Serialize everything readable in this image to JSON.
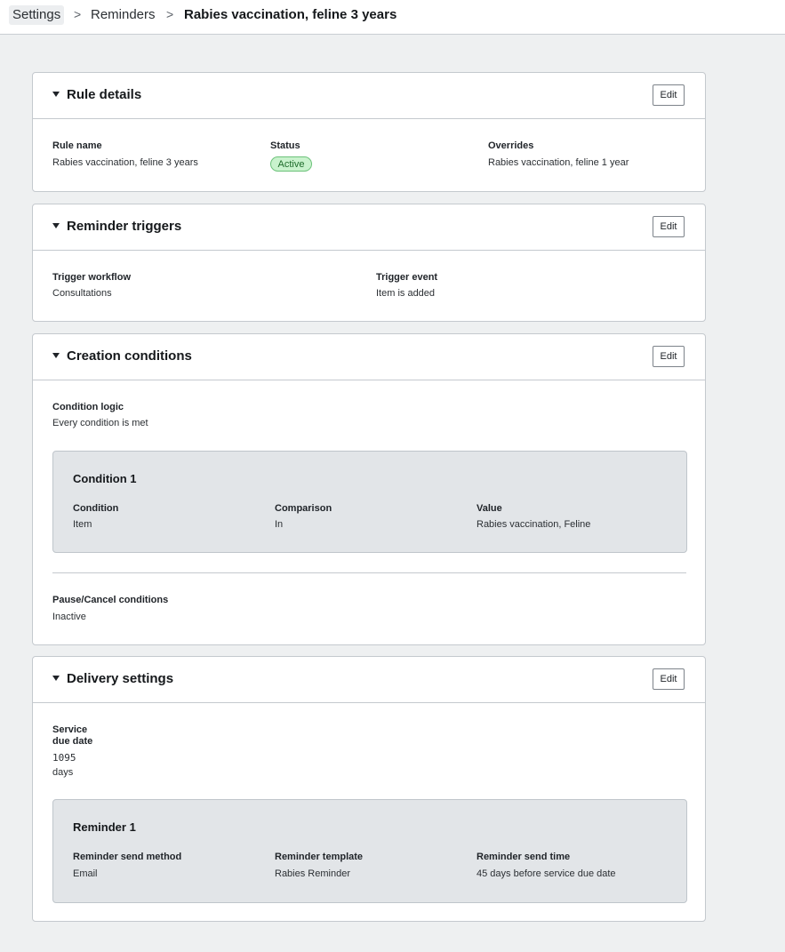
{
  "breadcrumb": {
    "items": [
      "Settings",
      "Reminders"
    ],
    "current": "Rabies vaccination, feline 3 years",
    "separator": ">"
  },
  "edit_label": "Edit",
  "rule_details": {
    "title": "Rule details",
    "rule_name_label": "Rule name",
    "rule_name": "Rabies vaccination, feline 3 years",
    "status_label": "Status",
    "status": "Active",
    "overrides_label": "Overrides",
    "overrides": "Rabies vaccination, feline 1 year"
  },
  "reminder_triggers": {
    "title": "Reminder triggers",
    "workflow_label": "Trigger workflow",
    "workflow": "Consultations",
    "event_label": "Trigger event",
    "event": "Item is added"
  },
  "creation_conditions": {
    "title": "Creation conditions",
    "logic_label": "Condition logic",
    "logic": "Every condition is met",
    "condition": {
      "title": "Condition 1",
      "condition_label": "Condition",
      "condition": "Item",
      "comparison_label": "Comparison",
      "comparison": "In",
      "value_label": "Value",
      "value": "Rabies vaccination, Feline"
    },
    "pause_label": "Pause/Cancel conditions",
    "pause": "Inactive"
  },
  "delivery_settings": {
    "title": "Delivery settings",
    "due_label_line1": "Service",
    "due_label_line2": "due date",
    "due_value": "1095",
    "due_unit": "days",
    "reminder": {
      "title": "Reminder 1",
      "method_label": "Reminder send method",
      "method": "Email",
      "template_label": "Reminder template",
      "template": "Rabies Reminder",
      "time_label": "Reminder send time",
      "time": "45 days before service due date"
    }
  },
  "colors": {
    "page_bg": "#eef0f1",
    "status_active_bg": "#c9f2cd",
    "status_active_border": "#6cc27a",
    "subpanel_bg": "#e2e5e8"
  }
}
